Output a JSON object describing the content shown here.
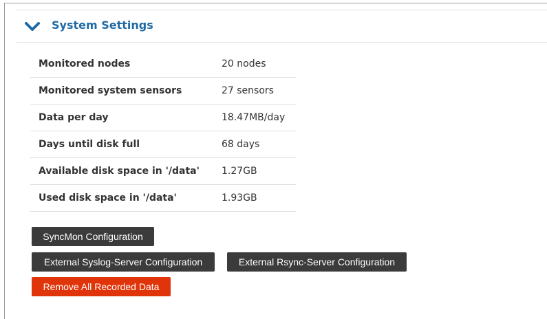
{
  "panel": {
    "title": "System Settings",
    "icon": "chevron-down-icon",
    "accent_color": "#1f6aa5"
  },
  "stats": [
    {
      "label": "Monitored nodes",
      "value": "20 nodes"
    },
    {
      "label": "Monitored system sensors",
      "value": "27 sensors"
    },
    {
      "label": "Data per day",
      "value": "18.47MB/day"
    },
    {
      "label": "Days until disk full",
      "value": "68 days"
    },
    {
      "label": "Available disk space in '/data'",
      "value": "1.27GB"
    },
    {
      "label": "Used disk space in '/data'",
      "value": "1.93GB"
    }
  ],
  "buttons": {
    "syncmon_config": "SyncMon Configuration",
    "syslog_config": "External Syslog-Server Configuration",
    "rsync_config": "External Rsync-Server Configuration",
    "remove_data": "Remove All Recorded Data"
  },
  "colors": {
    "button_dark": "#3b3b3b",
    "button_danger": "#e0340a"
  }
}
